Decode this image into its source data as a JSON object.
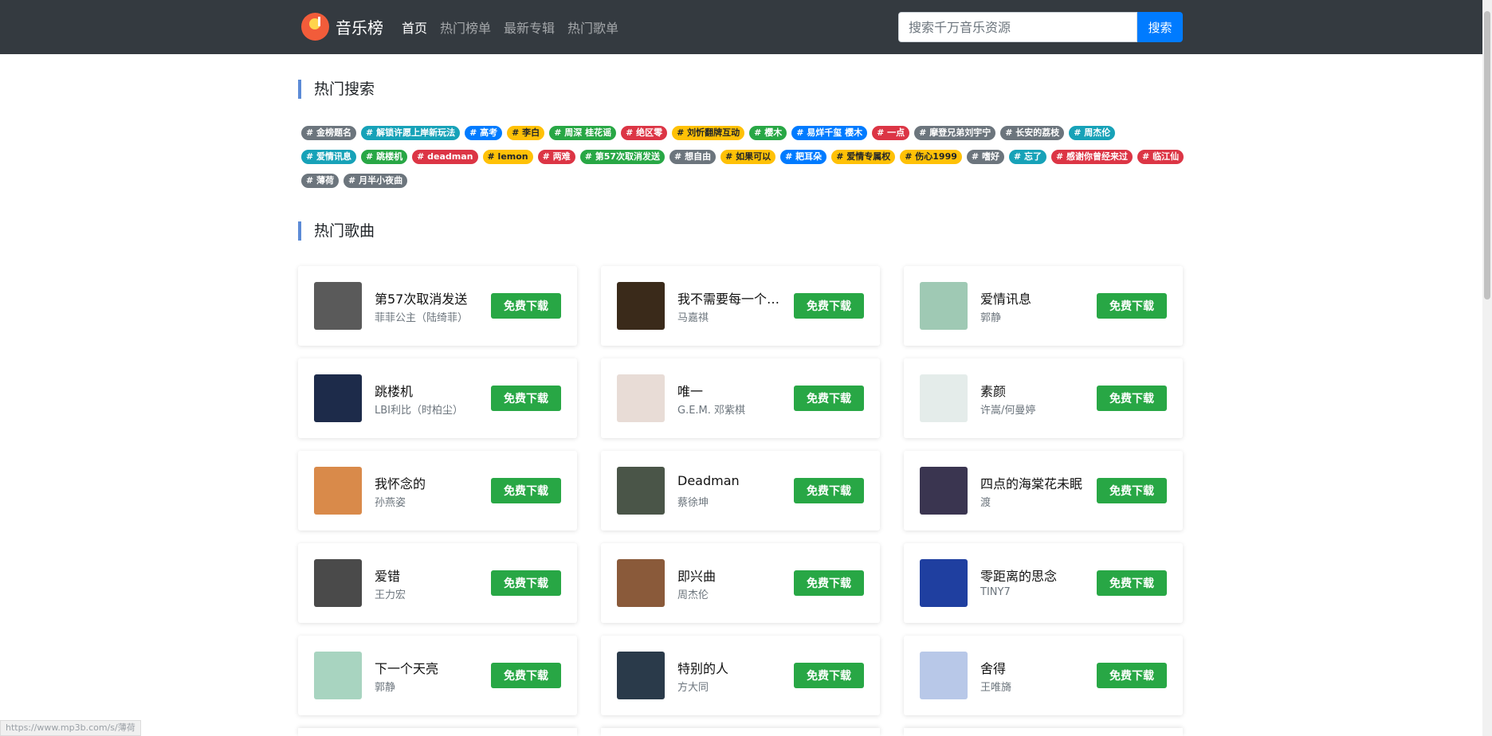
{
  "header": {
    "brand": "音乐榜",
    "nav": [
      {
        "label": "首页",
        "active": true
      },
      {
        "label": "热门榜单",
        "active": false
      },
      {
        "label": "最新专辑",
        "active": false
      },
      {
        "label": "热门歌单",
        "active": false
      }
    ],
    "search": {
      "placeholder": "搜索千万音乐资源",
      "value": "",
      "button": "搜索"
    }
  },
  "hot_search": {
    "title": "热门搜索",
    "rows": [
      [
        {
          "label": "# 金榜题名",
          "color": "gray"
        },
        {
          "label": "# 解锁许愿上岸新玩法",
          "color": "teal"
        },
        {
          "label": "# 高考",
          "color": "blue"
        },
        {
          "label": "# 李白",
          "color": "yellow"
        },
        {
          "label": "# 周深 桂花谣",
          "color": "green"
        },
        {
          "label": "# 绝区零",
          "color": "red"
        },
        {
          "label": "# 刘忻翻牌互动",
          "color": "yellow"
        },
        {
          "label": "# 樱木",
          "color": "green"
        },
        {
          "label": "# 易烊千玺 樱木",
          "color": "blue"
        },
        {
          "label": "# 一点",
          "color": "red"
        },
        {
          "label": "# 摩登兄弟刘宇宁",
          "color": "gray"
        },
        {
          "label": "# 长安的荔枝",
          "color": "gray"
        },
        {
          "label": "# 周杰伦",
          "color": "teal"
        }
      ],
      [
        {
          "label": "# 爱情讯息",
          "color": "teal"
        },
        {
          "label": "# 跳楼机",
          "color": "green"
        },
        {
          "label": "# deadman",
          "color": "red"
        },
        {
          "label": "# lemon",
          "color": "yellow"
        },
        {
          "label": "# 两难",
          "color": "red"
        },
        {
          "label": "# 第57次取消发送",
          "color": "green"
        },
        {
          "label": "# 想自由",
          "color": "gray"
        },
        {
          "label": "# 如果可以",
          "color": "yellow"
        },
        {
          "label": "# 耙耳朵",
          "color": "blue"
        },
        {
          "label": "# 爱情专属权",
          "color": "yellow"
        },
        {
          "label": "# 伤心1999",
          "color": "yellow"
        },
        {
          "label": "# 嗜好",
          "color": "gray"
        },
        {
          "label": "# 忘了",
          "color": "teal"
        },
        {
          "label": "# 感谢你曾经来过",
          "color": "red"
        },
        {
          "label": "# 临江仙",
          "color": "red"
        }
      ],
      [
        {
          "label": "# 薄荷",
          "color": "gray"
        },
        {
          "label": "# 月半小夜曲",
          "color": "gray"
        }
      ]
    ]
  },
  "hot_songs": {
    "title": "热门歌曲",
    "download_label": "免费下载",
    "songs": [
      {
        "title": "第57次取消发送",
        "artist": "菲菲公主（陆绮菲）",
        "cover": "#5a5a5a"
      },
      {
        "title": "我不需要每一个人...",
        "artist": "马嘉祺",
        "cover": "#3a2a1a"
      },
      {
        "title": "爱情讯息",
        "artist": "郭静",
        "cover": "#9fc9b4"
      },
      {
        "title": "跳楼机",
        "artist": "LBI利比（时柏尘）",
        "cover": "#1d2b4a"
      },
      {
        "title": "唯一",
        "artist": "G.E.M. 邓紫棋",
        "cover": "#e8dcd6"
      },
      {
        "title": "素颜",
        "artist": "许嵩/何曼婷",
        "cover": "#e4ecea"
      },
      {
        "title": "我怀念的",
        "artist": "孙燕姿",
        "cover": "#d98a4a"
      },
      {
        "title": "Deadman",
        "artist": "蔡徐坤",
        "cover": "#4a5548"
      },
      {
        "title": "四点的海棠花未眠",
        "artist": "渡",
        "cover": "#3a3550"
      },
      {
        "title": "爱错",
        "artist": "王力宏",
        "cover": "#4a4a4a"
      },
      {
        "title": "即兴曲",
        "artist": "周杰伦",
        "cover": "#8a5a3a"
      },
      {
        "title": "零距离的思念",
        "artist": "TINY7",
        "cover": "#1f3fa0"
      },
      {
        "title": "下一个天亮",
        "artist": "郭静",
        "cover": "#a8d4c0"
      },
      {
        "title": "特别的人",
        "artist": "方大同",
        "cover": "#2a3a4a"
      },
      {
        "title": "舍得",
        "artist": "王唯旖",
        "cover": "#b8c8e8"
      }
    ]
  },
  "status_bar": {
    "url": "https://www.mp3b.com/s/薄荷"
  }
}
